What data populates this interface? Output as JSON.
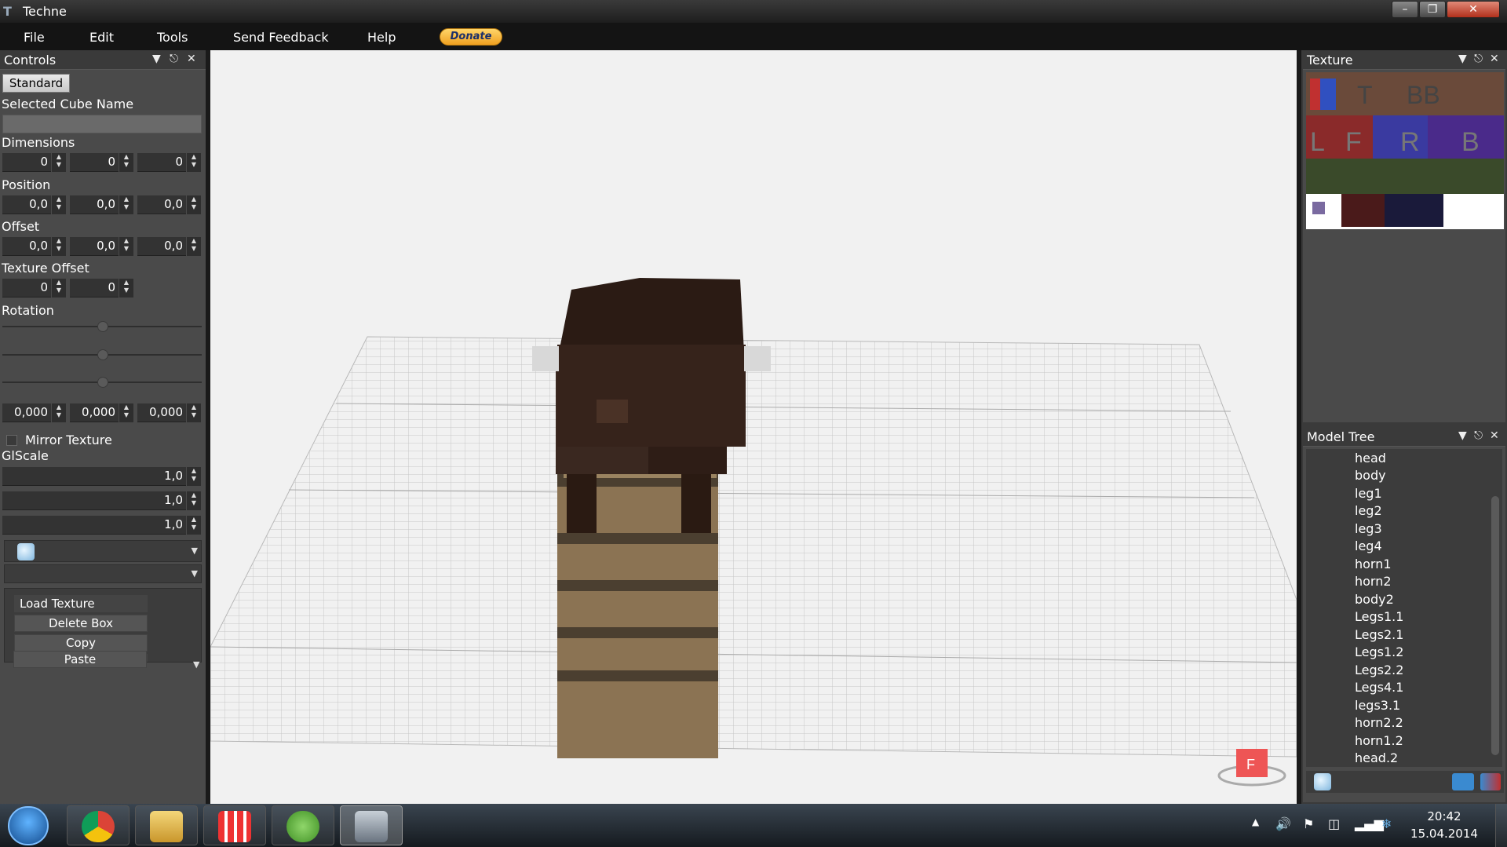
{
  "window": {
    "title": "Techne"
  },
  "menu": {
    "items": [
      "File",
      "Edit",
      "Tools",
      "Send Feedback",
      "Help"
    ],
    "donate_label": "Donate"
  },
  "controls_panel": {
    "title": "Controls",
    "tab_standard": "Standard",
    "selected_cube_name_label": "Selected Cube Name",
    "selected_cube_name_value": "",
    "dimensions_label": "Dimensions",
    "dimensions": [
      "0",
      "0",
      "0"
    ],
    "position_label": "Position",
    "position": [
      "0,0",
      "0,0",
      "0,0"
    ],
    "offset_label": "Offset",
    "offset": [
      "0,0",
      "0,0",
      "0,0"
    ],
    "texture_offset_label": "Texture Offset",
    "texture_offset": [
      "0",
      "0"
    ],
    "rotation_label": "Rotation",
    "rotation": [
      "0,000",
      "0,000",
      "0,000"
    ],
    "mirror_texture_label": "Mirror Texture",
    "mirror_texture_checked": false,
    "glscale_label": "GlScale",
    "glscale": [
      "1,0",
      "1,0",
      "1,0"
    ],
    "buttons": {
      "load_texture": "Load Texture",
      "delete_box": "Delete Box",
      "copy": "Copy",
      "paste": "Paste"
    }
  },
  "texture_panel": {
    "title": "Texture"
  },
  "model_tree": {
    "title": "Model Tree",
    "items": [
      "head",
      "body",
      "leg1",
      "leg2",
      "leg3",
      "leg4",
      "horn1",
      "horn2",
      "body2",
      "Legs1.1",
      "Legs2.1",
      "Legs1.2",
      "Legs2.2",
      "Legs4.1",
      "legs3.1",
      "horn2.2",
      "horn1.2",
      "head.2"
    ]
  },
  "taskbar": {
    "time": "20:42",
    "date": "15.04.2014",
    "apps": [
      "chrome-icon",
      "explorer-icon",
      "grid-app-icon",
      "utorrent-icon",
      "techne-icon"
    ]
  },
  "colors": {
    "panel_bg": "#4a4a4a",
    "viewport_bg": "#f1f1f1",
    "donate": "#f0a020"
  }
}
